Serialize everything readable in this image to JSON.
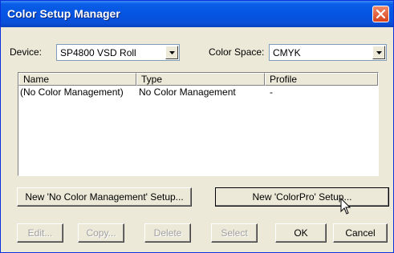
{
  "window": {
    "title": "Color Setup Manager"
  },
  "device": {
    "label": "Device:",
    "value": "SP4800 VSD Roll"
  },
  "color_space": {
    "label": "Color Space:",
    "value": "CMYK"
  },
  "list": {
    "columns": [
      "Name",
      "Type",
      "Profile"
    ],
    "rows": [
      {
        "name": "(No Color Management)",
        "type": "No Color Management",
        "profile": "-"
      }
    ]
  },
  "setup_buttons": {
    "new_no_cm": "New 'No Color Management' Setup...",
    "new_colorpro": "New 'ColorPro' Setup..."
  },
  "bottom_buttons": {
    "edit": "Edit...",
    "copy": "Copy...",
    "delete": "Delete",
    "select": "Select",
    "ok": "OK",
    "cancel": "Cancel"
  }
}
